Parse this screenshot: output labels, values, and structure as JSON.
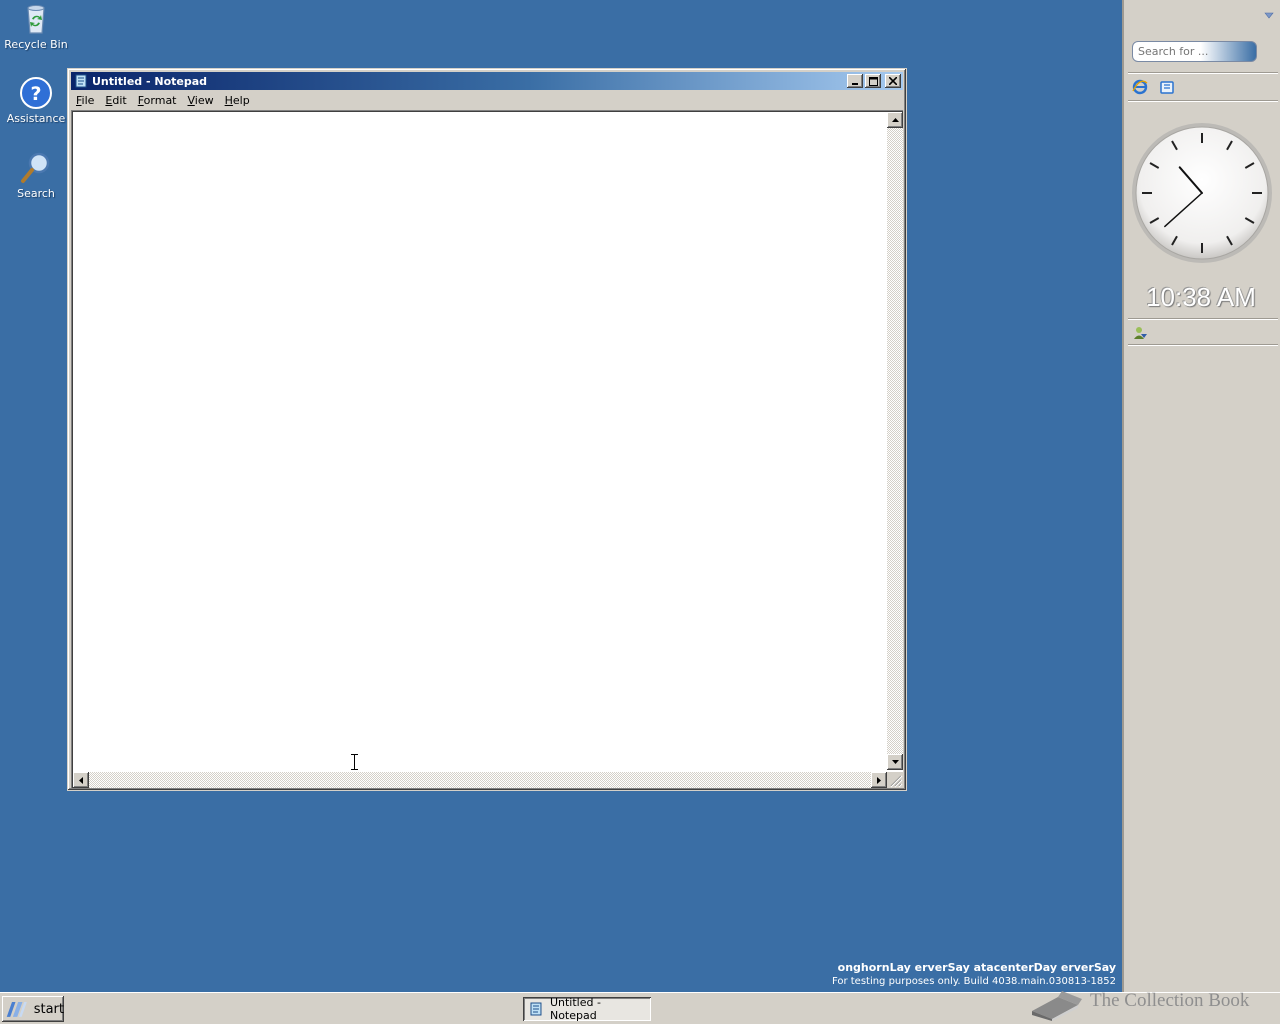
{
  "desktop": {
    "icons": [
      {
        "label": "Recycle Bin"
      },
      {
        "label": "Assistance"
      },
      {
        "label": "Search"
      }
    ]
  },
  "window": {
    "title": "Untitled - Notepad",
    "menu": [
      {
        "label_u": "F",
        "label_rest": "ile"
      },
      {
        "label_u": "E",
        "label_rest": "dit"
      },
      {
        "label_u": "F",
        "label_rest": "ormat"
      },
      {
        "label_u": "V",
        "label_rest": "iew"
      },
      {
        "label_u": "H",
        "label_rest": "elp"
      }
    ],
    "content": ""
  },
  "sidebar": {
    "search_placeholder": "Search for ...",
    "clock_time": "10:38 AM"
  },
  "taskbar": {
    "start_label": "start",
    "task_label": "Untitled - Notepad"
  },
  "watermark": {
    "line1": "onghornLay erverSay atacenterDay erverSay",
    "line2": "For testing purposes only. Build 4038.main.030813-1852"
  },
  "brand": {
    "text": "The Collection Book"
  },
  "colors": {
    "desktop": "#3a6ea5",
    "titlebar_start": "#0a246a",
    "face": "#d4d0c8"
  }
}
